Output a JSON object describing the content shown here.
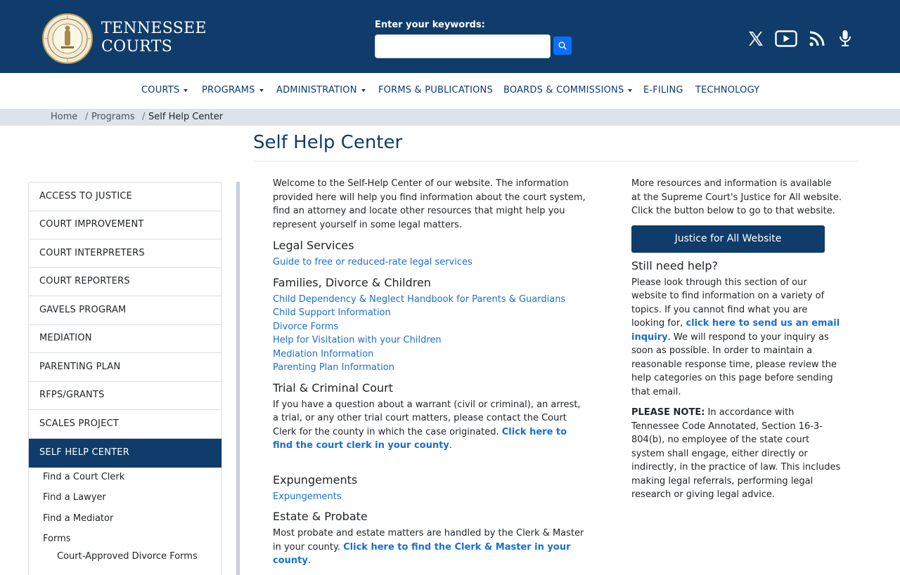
{
  "header": {
    "brand_line1": "TENNESSEE",
    "brand_line2": "COURTS",
    "search_label": "Enter your keywords:",
    "search_value": "",
    "social": [
      "x-icon",
      "youtube-icon",
      "rss-icon",
      "podcast-icon"
    ]
  },
  "nav": [
    {
      "label": "COURTS",
      "dropdown": true
    },
    {
      "label": "PROGRAMS",
      "dropdown": true
    },
    {
      "label": "ADMINISTRATION",
      "dropdown": true
    },
    {
      "label": "FORMS & PUBLICATIONS",
      "dropdown": false
    },
    {
      "label": "BOARDS & COMMISSIONS",
      "dropdown": true
    },
    {
      "label": "E-FILING",
      "dropdown": false
    },
    {
      "label": "TECHNOLOGY",
      "dropdown": false
    }
  ],
  "breadcrumb": {
    "home": "Home",
    "sep": "/",
    "programs": "Programs",
    "current": "Self Help Center"
  },
  "page_title": "Self Help Center",
  "sidebar": {
    "items": [
      "ACCESS TO JUSTICE",
      "COURT IMPROVEMENT",
      "COURT INTERPRETERS",
      "COURT REPORTERS",
      "GAVELS PROGRAM",
      "MEDIATION",
      "PARENTING PLAN",
      "RFPS/GRANTS",
      "SCALES PROJECT",
      "SELF HELP CENTER"
    ],
    "active": "SELF HELP CENTER",
    "sub_items": [
      "Find a Court Clerk",
      "Find a Lawyer",
      "Find a Mediator",
      "Forms"
    ],
    "sub_sub_items": [
      "Court-Approved Divorce Forms"
    ]
  },
  "main": {
    "intro": "Welcome to the Self-Help Center of our website. The information provided here will help you find information about the court system, find an attorney and locate other resources that might help you represent yourself in some legal matters.",
    "legal_services": {
      "heading": "Legal Services",
      "links": [
        "Guide to free or reduced-rate legal services"
      ]
    },
    "families": {
      "heading": "Families, Divorce & Children",
      "links": [
        "Child Dependency & Neglect Handbook for Parents & Guardians",
        "Child Support Information",
        "Divorce Forms",
        "Help for Visitation with your Children",
        "Mediation Information",
        "Parenting Plan Information"
      ]
    },
    "trial": {
      "heading": "Trial & Criminal Court",
      "text": "If you have a question about a warrant (civil or criminal), an arrest, a trial, or any other trial court matters, please contact the Court Clerk for the county in which the case originated.",
      "link": "Click here to find the court clerk in your county",
      "after": "."
    },
    "expungements": {
      "heading": "Expungements",
      "links": [
        "Expungements"
      ]
    },
    "estate": {
      "heading": "Estate & Probate",
      "text": "Most probate and estate matters are handled by the Clerk & Master in your county.",
      "link": "Click here to find the Clerk & Master in your county",
      "after": "."
    }
  },
  "right": {
    "intro": "More resources and information is available at the Supreme Court's Justice for All website. Click the button below to go to that website.",
    "button": "Justice for All Website",
    "still_heading": "Still need help?",
    "still_text_before": "Please look through this section of our website to find information on a variety of topics. If you cannot find what you are looking for,",
    "still_link": "click here to send us an email inquiry",
    "still_text_after": ". We will respond to your inquiry as soon as possible. In order to maintain a reasonable response time, please review the help categories on this page before sending that email.",
    "note_label": "PLEASE NOTE:",
    "note_text": "In accordance with Tennessee Code Annotated, Section 16-3-804(b), no employee of the state court system shall engage, either directly or indirectly, in the practice of law. This includes making legal referrals, performing legal research or giving legal advice."
  }
}
